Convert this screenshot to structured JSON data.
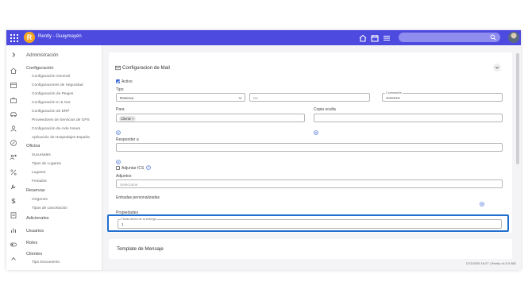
{
  "app": {
    "logo_letter": "R",
    "title": "Rently - Guaymayén"
  },
  "topbar": {
    "icons": [
      "home-icon",
      "calendar-icon",
      "menu-icon"
    ],
    "search_placeholder": ""
  },
  "sidebar": {
    "admin_label": "Administración",
    "config_label": "Configuración",
    "config_items": [
      "Configuración General",
      "Configuraciones de Seguridad",
      "Configuración de Peajes",
      "Configuración In & Out",
      "Configuración de ERP",
      "Proveedores de Servicios de GPS",
      "Configuración de Axle Insure",
      "Aplicación de Hospedajes España"
    ],
    "oficina_label": "Oficina",
    "oficina_items": [
      "Sucursales",
      "Tipos de Lugares",
      "Lugares",
      "Feriados"
    ],
    "reservas_label": "Reservas",
    "reservas_items": [
      "Orígenes",
      "Tipos de cancelación"
    ],
    "adicionales_label": "Adicionales",
    "usuarios_label": "Usuarios",
    "roles_label": "Roles",
    "clientes_label": "Clientes",
    "clientes_items": [
      "Tipo Documento"
    ]
  },
  "form": {
    "title": "Configuracion de Mail",
    "activo_label": "Activo",
    "activo_checked": true,
    "tipo_label": "Tipo",
    "tipo_value": "Reserva",
    "de_placeholder": "De",
    "contrasena_label": "Contraseña",
    "contrasena_value": "•••••••••••",
    "para_label": "Para",
    "para_chip": "Cliente ×",
    "copia_label": "Copia oculta",
    "responder_label": "Responder a",
    "ics_label": "Adjuntar ICS",
    "ics_checked": false,
    "adjuntos_label": "Adjuntos",
    "adjuntos_placeholder": "Seleccione",
    "entradas_label": "Entradas personalizadas",
    "propiedades_label": "Propiedades",
    "horas_label": "Horas antes de la entrega",
    "horas_value": "1"
  },
  "template": {
    "title": "Template de Mensaje"
  },
  "footer": {
    "text": "17/2/2025 16:27 | Rently v4.5.0.882"
  },
  "colors": {
    "topbar": "#4d4ae0",
    "accent": "#3d6ad6",
    "highlight": "#1f6fd1"
  }
}
